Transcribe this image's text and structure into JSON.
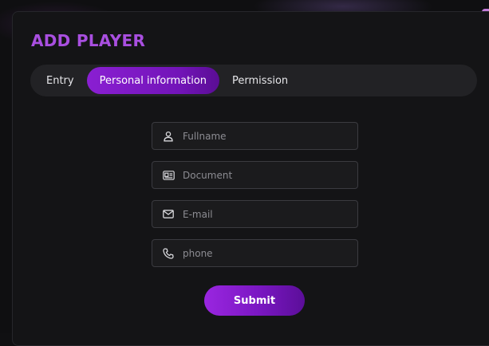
{
  "modal": {
    "title": "ADD PLAYER",
    "tabs": [
      {
        "label": "Entry",
        "active": false
      },
      {
        "label": "Personal information",
        "active": true
      },
      {
        "label": "Permission",
        "active": false
      }
    ]
  },
  "form": {
    "fullname": {
      "placeholder": "Fullname",
      "value": "",
      "icon": "user-icon"
    },
    "document": {
      "placeholder": "Document",
      "value": "",
      "icon": "id-card-icon"
    },
    "email": {
      "placeholder": "E-mail",
      "value": "",
      "icon": "mail-icon"
    },
    "phone": {
      "placeholder": "phone",
      "value": "",
      "icon": "phone-icon"
    },
    "submit_label": "Submit"
  },
  "colors": {
    "accent": "#8a1fd2",
    "title": "#a94fe0",
    "background": "#141416",
    "field_border": "#3b3b40"
  }
}
